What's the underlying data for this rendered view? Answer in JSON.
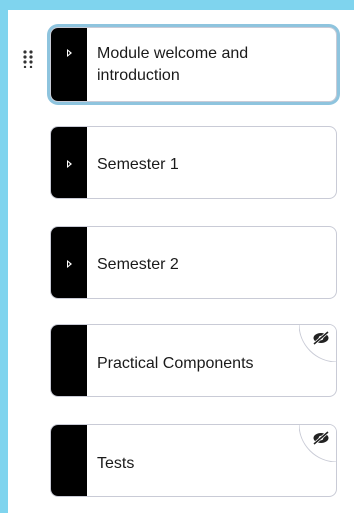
{
  "modules": [
    {
      "title": "Module welcome and introduction",
      "title_line1": "Module welcome and",
      "title_line2": "introduction",
      "expand_icon": "caret-right-icon",
      "hidden": false,
      "focused": true
    },
    {
      "title": "Semester 1",
      "expand_icon": "caret-right-icon",
      "hidden": false,
      "focused": false
    },
    {
      "title": "Semester 2",
      "expand_icon": "caret-right-icon",
      "hidden": false,
      "focused": false
    },
    {
      "title": "Practical Components",
      "hidden": true,
      "hidden_icon": "eye-slash-icon",
      "focused": false
    },
    {
      "title": "Tests",
      "hidden": true,
      "hidden_icon": "eye-slash-icon",
      "focused": false
    }
  ],
  "drag_handle_icon": "drag-handle-icon",
  "colors": {
    "accent_strip": "#7fd4ee",
    "focus_ring": "#8ec4de",
    "card_bar": "#000000",
    "card_border": "#c9cbd6"
  }
}
